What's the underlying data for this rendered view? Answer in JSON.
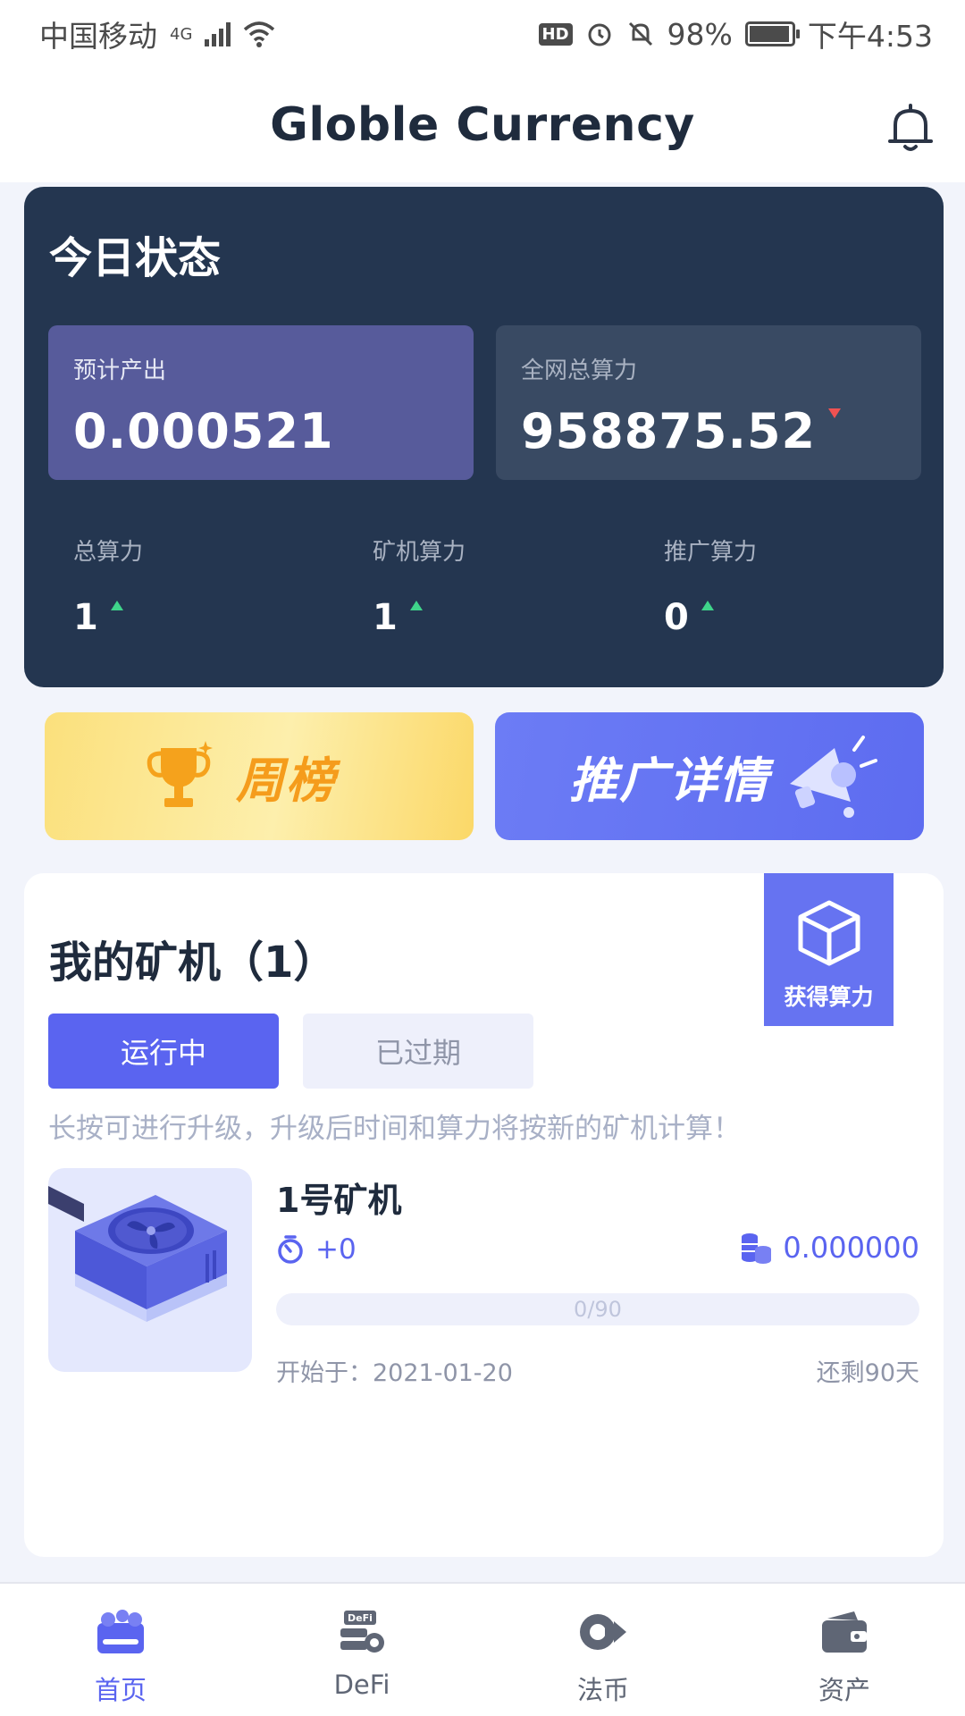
{
  "status_bar": {
    "carrier": "中国移动",
    "network": "4G",
    "battery": "98%",
    "time": "下午4:53",
    "hd": "HD"
  },
  "header": {
    "title": "Globle Currency"
  },
  "today": {
    "title": "今日状态",
    "expected_output_label": "预计产出",
    "expected_output_value": "0.000521",
    "network_power_label": "全网总算力",
    "network_power_value": "958875.52",
    "stats": [
      {
        "label": "总算力",
        "value": "1"
      },
      {
        "label": "矿机算力",
        "value": "1"
      },
      {
        "label": "推广算力",
        "value": "0"
      }
    ]
  },
  "banners": {
    "weekly": "周榜",
    "promotion": "推广详情"
  },
  "miners": {
    "title": "我的矿机（1）",
    "get_power": "获得算力",
    "tab_running": "运行中",
    "tab_expired": "已过期",
    "hint": "长按可进行升级，升级后时间和算力将按新的矿机计算！",
    "items": [
      {
        "name": "1号矿机",
        "timer": "+0",
        "coins": "0.000000",
        "progress_text": "0/90",
        "progress_fraction": 0,
        "start": "开始于：2021-01-20",
        "remaining": "还剩90天"
      }
    ]
  },
  "nav": [
    {
      "label": "首页",
      "icon": "home-icon",
      "active": true
    },
    {
      "label": "DeFi",
      "icon": "defi-icon",
      "active": false
    },
    {
      "label": "法币",
      "icon": "fiat-exchange-icon",
      "active": false
    },
    {
      "label": "资产",
      "icon": "wallet-icon",
      "active": false
    }
  ],
  "colors": {
    "accent": "#5a64f0",
    "card_dark": "#243650",
    "up": "#3fd48a",
    "down": "#f05252"
  }
}
